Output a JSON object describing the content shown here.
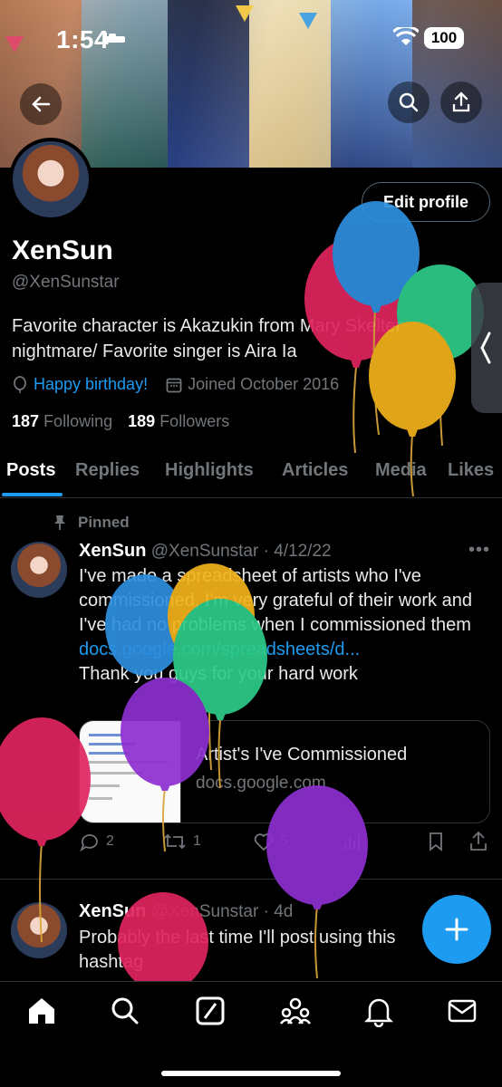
{
  "status_bar": {
    "time": "1:54",
    "battery": "100"
  },
  "banner": {
    "colors": [
      "#7a5a3c",
      "#3d6f7a",
      "#e9d6a8",
      "#4d7bc8"
    ]
  },
  "header": {
    "back_icon": "arrow-left-icon",
    "search_icon": "search-icon",
    "share_icon": "share-icon"
  },
  "profile": {
    "edit_label": "Edit profile",
    "display_name": "XenSun",
    "handle": "@XenSunstar",
    "bio": "Favorite character is Akazukin from Mary Skelter nightmare/ Favorite singer is Aira Ia",
    "birthday": "Happy birthday!",
    "joined": "Joined October 2016",
    "following_count": "187",
    "following_label": "Following",
    "followers_count": "189",
    "followers_label": "Followers"
  },
  "tabs": [
    "Posts",
    "Replies",
    "Highlights",
    "Articles",
    "Media",
    "Likes"
  ],
  "posts": [
    {
      "pinned_label": "Pinned",
      "name": "XenSun",
      "handle": "@XenSunstar",
      "date": "· 4/12/22",
      "text": "I've made a spreadsheet of artists who I've commissioned, I'm very grateful of their work and I've had no problems when I commissioned them",
      "link": "docs.google.com/spreadsheets/d...",
      "text2": "Thank you guys for your hard work",
      "card_title": "Artist's I've Commissioned",
      "card_domain": "docs.google.com",
      "replies": "2",
      "reposts": "1",
      "likes": "5"
    },
    {
      "name": "XenSun",
      "handle": "@XenSunstar",
      "date": "· 4d",
      "text": "Probably the last time I'll post using this hashtag"
    }
  ],
  "balloon_colors": {
    "red": "#e0245e",
    "blue": "#2f8fe0",
    "green": "#2ecc8a",
    "yellow": "#f2b21b",
    "purple": "#8e2fd0"
  },
  "accent": "#1d9bf0"
}
